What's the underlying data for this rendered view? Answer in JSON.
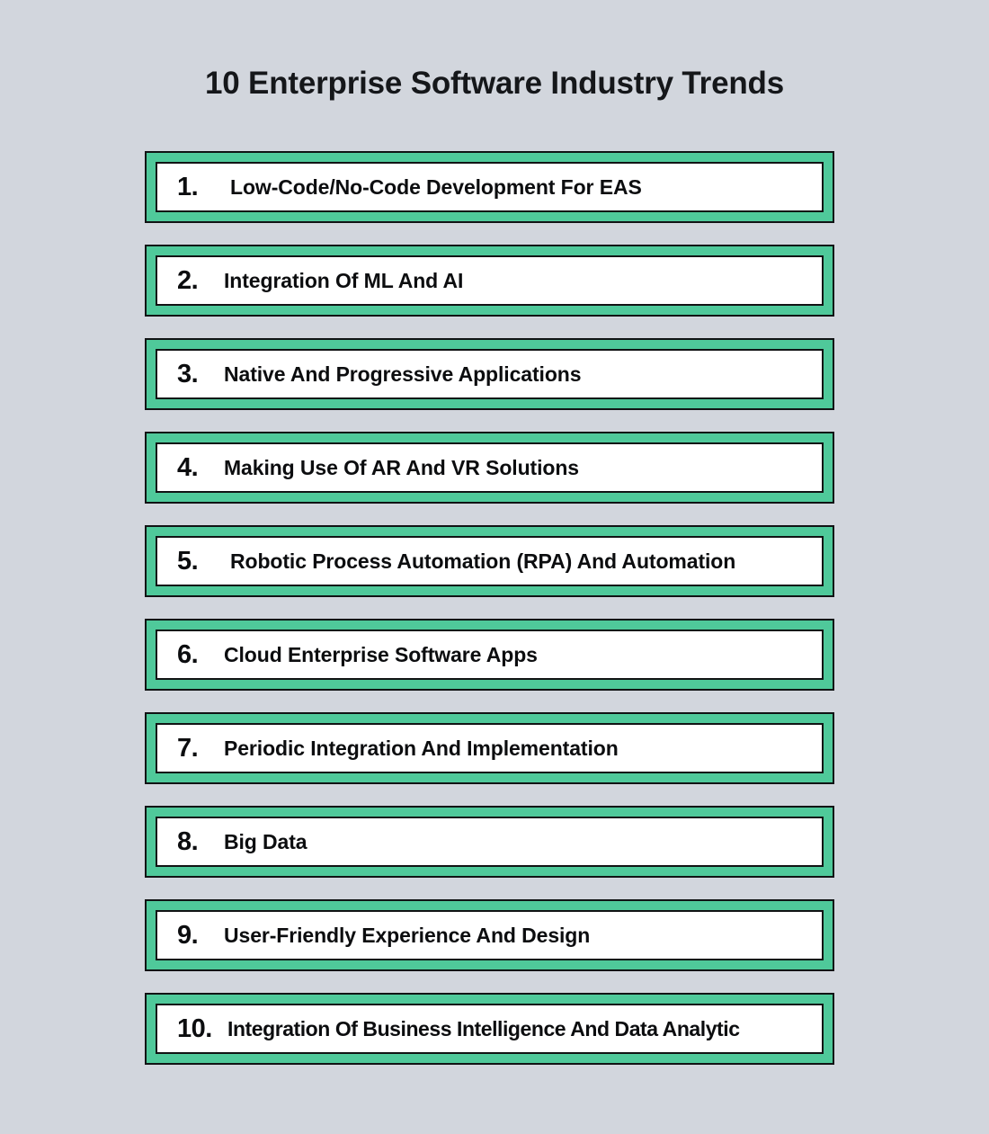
{
  "page": {
    "title": "10 Enterprise Software Industry Trends",
    "background_color": "#d2d6dd",
    "accent_color": "#4fc99a",
    "border_color": "#111314",
    "card_color": "#ffffff",
    "text_color": "#0c0d0f"
  },
  "trends": [
    {
      "number": "1.",
      "label": "Low-Code/No-Code Development For EAS"
    },
    {
      "number": "2.",
      "label": "Integration Of ML And AI"
    },
    {
      "number": "3.",
      "label": "Native And Progressive Applications"
    },
    {
      "number": "4.",
      "label": "Making Use Of AR And VR Solutions"
    },
    {
      "number": "5.",
      "label": "Robotic Process Automation (RPA) And Automation"
    },
    {
      "number": "6.",
      "label": "Cloud Enterprise Software Apps"
    },
    {
      "number": "7.",
      "label": "Periodic Integration And Implementation"
    },
    {
      "number": "8.",
      "label": "Big Data"
    },
    {
      "number": "9.",
      "label": "User-Friendly Experience And Design"
    },
    {
      "number": "10.",
      "label": "Integration Of Business Intelligence And Data Analytic"
    }
  ]
}
